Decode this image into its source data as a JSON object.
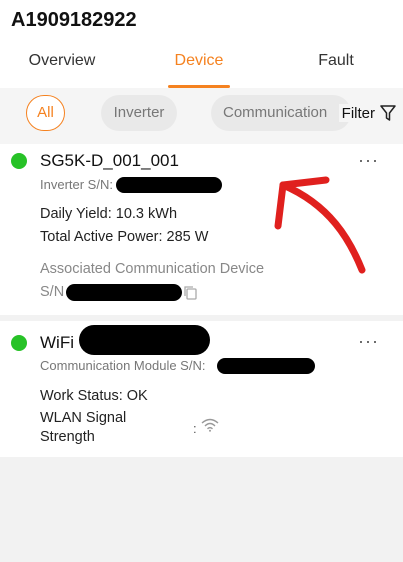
{
  "header": {
    "title": "A1909182922"
  },
  "tabs": [
    {
      "label": "Overview",
      "active": false
    },
    {
      "label": "Device",
      "active": true
    },
    {
      "label": "Fault",
      "active": false
    }
  ],
  "filters": {
    "chips": [
      {
        "label": "All",
        "active": true
      },
      {
        "label": "Inverter",
        "active": false
      },
      {
        "label": "Communication",
        "active": false
      }
    ],
    "filter_label": "Filter"
  },
  "devices": [
    {
      "name": "SG5K-D_001_001",
      "status_color": "#27c227",
      "serial_label": "Inverter S/N:",
      "daily_yield": "Daily Yield: 10.3 kWh",
      "total_power": "Total Active Power: 285 W",
      "assoc_label": "Associated Communication Device",
      "assoc_sn_label": "S/N"
    },
    {
      "name": "WiFi",
      "status_color": "#27c227",
      "serial_label": "Communication Module S/N:",
      "work_status": "Work Status: OK",
      "wlan_label_line1": "WLAN Signal",
      "wlan_label_line2": "Strength",
      "wlan_sep": ":"
    }
  ],
  "more_label": "···",
  "colors": {
    "accent": "#f58220",
    "online": "#27c227",
    "annotation": "#e0201e"
  }
}
